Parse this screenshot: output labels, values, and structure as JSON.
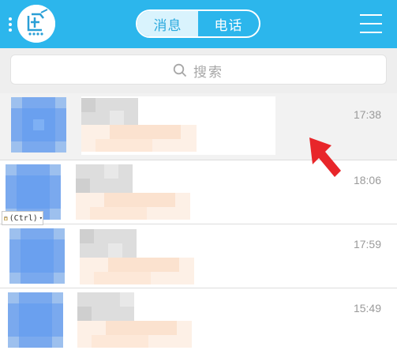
{
  "header": {
    "tabs": [
      {
        "label": "消息",
        "active": true
      },
      {
        "label": "电话",
        "active": false
      }
    ],
    "bg_color": "#2cb6ec",
    "logo_icon": "fish-logo-icon",
    "menu_icon": "hamburger-menu-icon",
    "more_icon": "vertical-dots-icon"
  },
  "search": {
    "placeholder": "搜索",
    "icon": "search-icon"
  },
  "conversations": [
    {
      "time": "17:38",
      "selected": true
    },
    {
      "time": "18:06",
      "selected": false
    },
    {
      "time": "17:59",
      "selected": false
    },
    {
      "time": "15:49",
      "selected": false
    }
  ],
  "paste_badge": {
    "label": "(Ctrl)",
    "icon": "clipboard-icon"
  },
  "annotation": {
    "icon": "red-arrow-icon",
    "color": "#e8262a"
  }
}
